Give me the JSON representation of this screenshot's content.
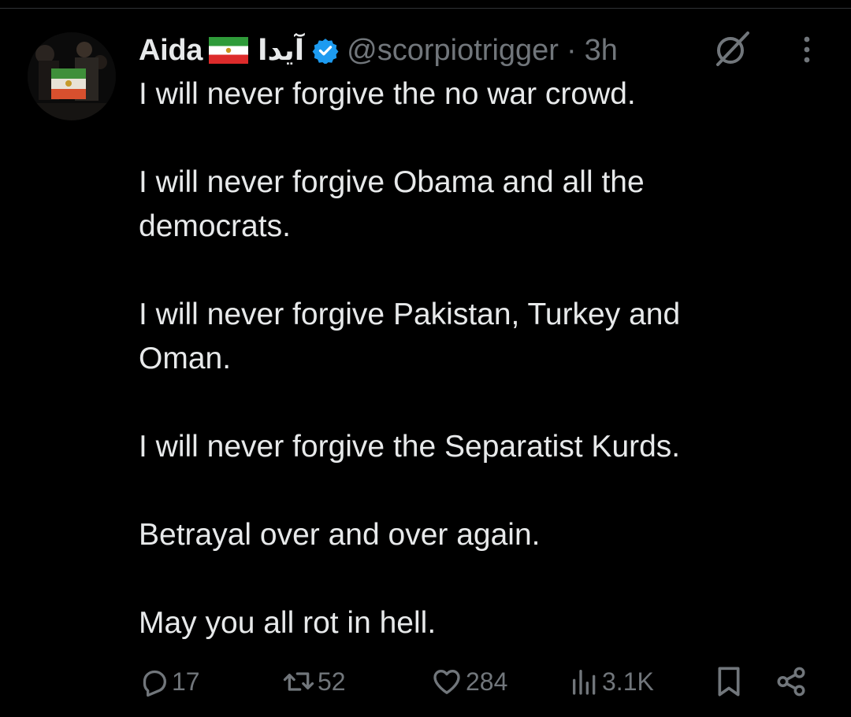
{
  "author": {
    "display_name": "Aida",
    "flag_icon": "iran-lion-and-sun-flag-icon",
    "alt_name": "آیدا",
    "verified_icon": "verified-badge-icon",
    "verified_color": "#1d9bf0",
    "handle": "@scorpiotrigger",
    "separator": "·",
    "timestamp": "3h"
  },
  "tweet": {
    "text": "I will never forgive the no war crowd.\n\nI will never forgive Obama and all the\ndemocrats.\n\nI will never forgive Pakistan, Turkey and\nOman.\n\nI will never forgive the Separatist Kurds.\n\nBetrayal over and over again.\n\nMay you all rot in hell."
  },
  "actions": {
    "reply": {
      "icon": "reply-icon",
      "count": "17"
    },
    "repost": {
      "icon": "repost-icon",
      "count": "52"
    },
    "like": {
      "icon": "heart-icon",
      "count": "284"
    },
    "views": {
      "icon": "views-icon",
      "count": "3.1K"
    },
    "bookmark": {
      "icon": "bookmark-icon"
    },
    "share": {
      "icon": "share-icon"
    }
  },
  "colors": {
    "background": "#000000",
    "text": "#e7e9ea",
    "secondary": "#71767b"
  }
}
